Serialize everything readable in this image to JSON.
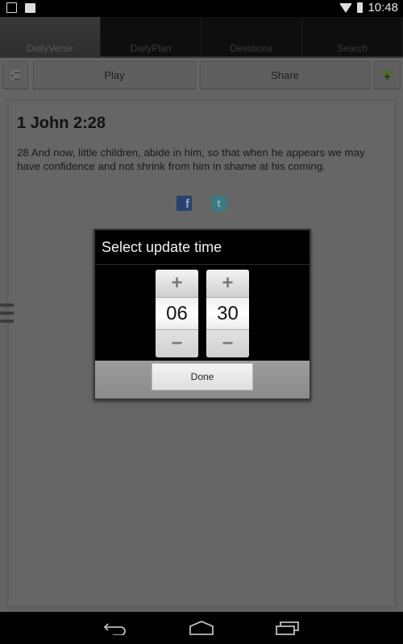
{
  "status_bar": {
    "time": "10:48",
    "icons_left": [
      "image-notification-icon",
      "clipboard-notification-icon"
    ],
    "icons_right": [
      "wifi-icon",
      "battery-icon"
    ]
  },
  "tabs": [
    {
      "label": "DailyVerse",
      "active": true
    },
    {
      "label": "DailyPlan",
      "active": false
    },
    {
      "label": "Devotions",
      "active": false
    },
    {
      "label": "Search",
      "active": false
    }
  ],
  "toolbar": {
    "play_label": "Play",
    "share_label": "Share",
    "menu_icon": "list-icon",
    "favorite_icon": "heart-plus-icon"
  },
  "verse": {
    "reference": "1 John 2:28",
    "text": "28 And now, little children, abide in him, so that when he appears we may have confidence and not shrink from him in shame at his coming."
  },
  "social": {
    "facebook_glyph": "f",
    "twitter_glyph": "t"
  },
  "dialog": {
    "title": "Select update time",
    "hour": "06",
    "minute": "30",
    "increment_glyph": "+",
    "decrement_glyph": "−",
    "done_label": "Done"
  },
  "colors": {
    "overlay_gray": "#646464",
    "facebook": "#2a4170",
    "twitter": "#3b7b84",
    "favorite_green": "#4d6b2a"
  }
}
